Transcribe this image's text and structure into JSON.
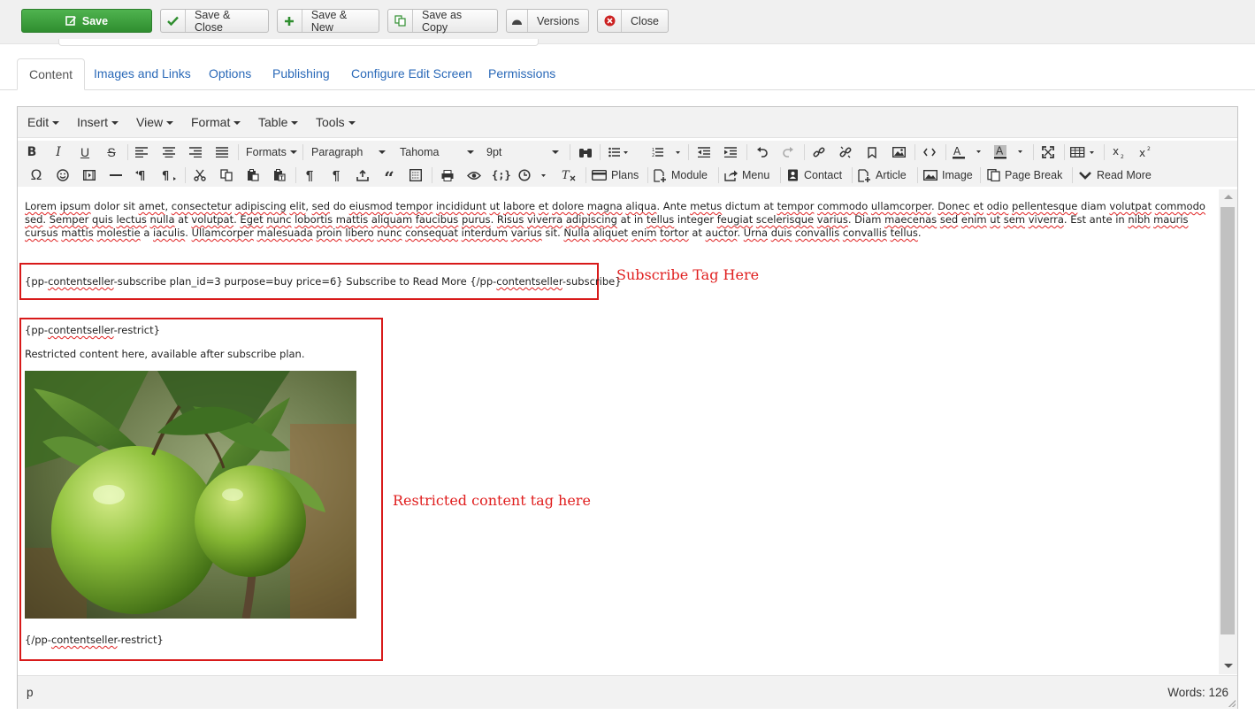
{
  "toolbar": {
    "save": "Save",
    "save_close": "Save & Close",
    "save_new": "Save & New",
    "save_copy": "Save as Copy",
    "versions": "Versions",
    "close": "Close"
  },
  "tabs": [
    "Content",
    "Images and Links",
    "Options",
    "Publishing",
    "Configure Edit Screen",
    "Permissions"
  ],
  "menubar": [
    "Edit",
    "Insert",
    "View",
    "Format",
    "Table",
    "Tools"
  ],
  "format_controls": {
    "formats": "Formats",
    "block": "Paragraph",
    "font": "Tahoma",
    "size": "9pt"
  },
  "plugin_buttons": {
    "plans": "Plans",
    "module": "Module",
    "menu": "Menu",
    "contact": "Contact",
    "article": "Article",
    "image": "Image",
    "page_break": "Page Break",
    "read_more": "Read More"
  },
  "content": {
    "lorem": [
      {
        "t": "Lorem",
        "s": true
      },
      {
        "t": " "
      },
      {
        "t": "ipsum",
        "s": true
      },
      {
        "t": " dolor sit "
      },
      {
        "t": "amet",
        "s": true
      },
      {
        "t": ", "
      },
      {
        "t": "consectetur",
        "s": true
      },
      {
        "t": " "
      },
      {
        "t": "adipiscing",
        "s": true
      },
      {
        "t": " "
      },
      {
        "t": "elit",
        "s": true
      },
      {
        "t": ", "
      },
      {
        "t": "sed",
        "s": true
      },
      {
        "t": " do "
      },
      {
        "t": "eiusmod",
        "s": true
      },
      {
        "t": " "
      },
      {
        "t": "tempor",
        "s": true
      },
      {
        "t": " "
      },
      {
        "t": "incididunt",
        "s": true
      },
      {
        "t": " "
      },
      {
        "t": "ut",
        "s": true
      },
      {
        "t": " "
      },
      {
        "t": "labore",
        "s": true
      },
      {
        "t": " "
      },
      {
        "t": "et",
        "s": true
      },
      {
        "t": " "
      },
      {
        "t": "dolore",
        "s": true
      },
      {
        "t": " "
      },
      {
        "t": "magna",
        "s": true
      },
      {
        "t": " "
      },
      {
        "t": "aliqua",
        "s": true
      },
      {
        "t": ". Ante "
      },
      {
        "t": "metus",
        "s": true
      },
      {
        "t": " dictum at "
      },
      {
        "t": "tempor",
        "s": true
      },
      {
        "t": " "
      },
      {
        "t": "commodo",
        "s": true
      },
      {
        "t": " "
      },
      {
        "t": "ullamcorper",
        "s": true
      },
      {
        "t": ". "
      },
      {
        "t": "Donec",
        "s": true
      },
      {
        "t": " "
      },
      {
        "t": "et",
        "s": true
      },
      {
        "t": " "
      },
      {
        "t": "odio",
        "s": true
      },
      {
        "t": " "
      },
      {
        "t": "pellentesque",
        "s": true
      },
      {
        "t": " diam "
      },
      {
        "t": "volutpat",
        "s": true
      },
      {
        "t": " "
      },
      {
        "t": "commodo",
        "s": true
      },
      {
        "t": " "
      },
      {
        "t": "sed",
        "s": true
      },
      {
        "t": ". "
      },
      {
        "t": "Semper",
        "s": true
      },
      {
        "t": " "
      },
      {
        "t": "quis",
        "s": true
      },
      {
        "t": " "
      },
      {
        "t": "lectus",
        "s": true
      },
      {
        "t": " "
      },
      {
        "t": "nulla",
        "s": true
      },
      {
        "t": " at "
      },
      {
        "t": "volutpat",
        "s": true
      },
      {
        "t": ". "
      },
      {
        "t": "Eget",
        "s": true
      },
      {
        "t": " "
      },
      {
        "t": "nunc",
        "s": true
      },
      {
        "t": " "
      },
      {
        "t": "lobortis",
        "s": true
      },
      {
        "t": " "
      },
      {
        "t": "mattis",
        "s": true
      },
      {
        "t": " "
      },
      {
        "t": "aliquam",
        "s": true
      },
      {
        "t": " "
      },
      {
        "t": "faucibus",
        "s": true
      },
      {
        "t": " "
      },
      {
        "t": "purus",
        "s": true
      },
      {
        "t": ". "
      },
      {
        "t": "Risus",
        "s": true
      },
      {
        "t": " "
      },
      {
        "t": "viverra",
        "s": true
      },
      {
        "t": " "
      },
      {
        "t": "adipiscing",
        "s": true
      },
      {
        "t": " at in "
      },
      {
        "t": "tellus",
        "s": true
      },
      {
        "t": " integer "
      },
      {
        "t": "feugiat",
        "s": true
      },
      {
        "t": " "
      },
      {
        "t": "scelerisque",
        "s": true
      },
      {
        "t": " "
      },
      {
        "t": "varius",
        "s": true
      },
      {
        "t": ". Diam "
      },
      {
        "t": "maecenas",
        "s": true
      },
      {
        "t": " "
      },
      {
        "t": "sed",
        "s": true
      },
      {
        "t": " "
      },
      {
        "t": "enim",
        "s": true
      },
      {
        "t": " "
      },
      {
        "t": "ut",
        "s": true
      },
      {
        "t": " "
      },
      {
        "t": "sem",
        "s": true
      },
      {
        "t": " "
      },
      {
        "t": "viverra",
        "s": true
      },
      {
        "t": ". Est ante in "
      },
      {
        "t": "nibh",
        "s": true
      },
      {
        "t": " "
      },
      {
        "t": "mauris",
        "s": true
      },
      {
        "t": " "
      },
      {
        "t": "cursus",
        "s": true
      },
      {
        "t": " "
      },
      {
        "t": "mattis",
        "s": true
      },
      {
        "t": " "
      },
      {
        "t": "molestie",
        "s": true
      },
      {
        "t": " a "
      },
      {
        "t": "iaculis",
        "s": true
      },
      {
        "t": ". "
      },
      {
        "t": "Ullamcorper",
        "s": true
      },
      {
        "t": " "
      },
      {
        "t": "malesuada",
        "s": true
      },
      {
        "t": " "
      },
      {
        "t": "proin",
        "s": true
      },
      {
        "t": " "
      },
      {
        "t": "libero",
        "s": true
      },
      {
        "t": " "
      },
      {
        "t": "nunc",
        "s": true
      },
      {
        "t": " "
      },
      {
        "t": "consequat",
        "s": true
      },
      {
        "t": " "
      },
      {
        "t": "interdum",
        "s": true
      },
      {
        "t": " "
      },
      {
        "t": "varius",
        "s": true
      },
      {
        "t": " sit. "
      },
      {
        "t": "Nulla",
        "s": true
      },
      {
        "t": " "
      },
      {
        "t": "aliquet",
        "s": true
      },
      {
        "t": " "
      },
      {
        "t": "enim",
        "s": true
      },
      {
        "t": " "
      },
      {
        "t": "tortor",
        "s": true
      },
      {
        "t": " at "
      },
      {
        "t": "auctor",
        "s": true
      },
      {
        "t": ". "
      },
      {
        "t": "Urna",
        "s": true
      },
      {
        "t": " "
      },
      {
        "t": "duis",
        "s": true
      },
      {
        "t": " "
      },
      {
        "t": "convallis",
        "s": true
      },
      {
        "t": " "
      },
      {
        "t": "convallis",
        "s": true
      },
      {
        "t": " "
      },
      {
        "t": "tellus",
        "s": true
      },
      {
        "t": "."
      }
    ],
    "subscribe_tag": [
      {
        "t": "{pp-"
      },
      {
        "t": "contentseller",
        "s": true
      },
      {
        "t": "-subscribe plan_id=3 purpose=buy price=6} Subscribe to Read More  {/pp-"
      },
      {
        "t": "contentseller",
        "s": true
      },
      {
        "t": "-subscribe}"
      }
    ],
    "restrict_open": [
      {
        "t": "{pp-"
      },
      {
        "t": "contentseller",
        "s": true
      },
      {
        "t": "-restrict}"
      }
    ],
    "restricted_text": "Restricted content here, available after subscribe plan.",
    "restrict_close": [
      {
        "t": "{/pp-"
      },
      {
        "t": "contentseller",
        "s": true
      },
      {
        "t": "-restrict}"
      }
    ]
  },
  "annotations": {
    "subscribe": "Subscribe Tag Here",
    "restricted": "Restricted content tag here"
  },
  "status": {
    "path": "p",
    "words": "Words: 126"
  },
  "colors": {
    "save_green": "#3da23d",
    "annotation_red": "#e01e1e",
    "tab_link": "#2a69b8"
  }
}
